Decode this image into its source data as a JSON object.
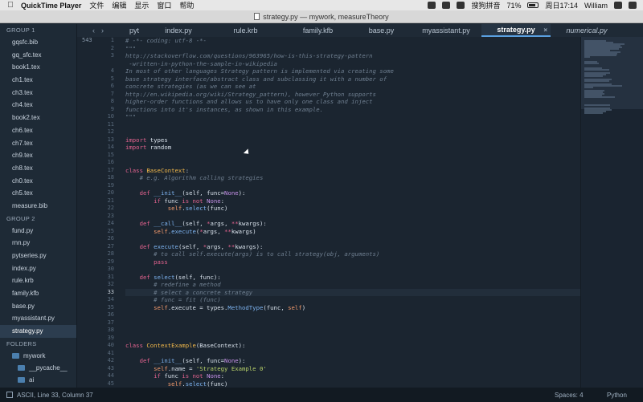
{
  "menubar": {
    "app_name": "QuickTime Player",
    "menus": [
      "文件",
      "编辑",
      "显示",
      "窗口",
      "帮助"
    ],
    "input_method": "搜狗拼音",
    "battery": "71%",
    "datetime": "周日17:14",
    "user": "William"
  },
  "window": {
    "title": "strategy.py — mywork, measureTheory"
  },
  "tabs": [
    {
      "label": "pyt"
    },
    {
      "label": "index.py"
    },
    {
      "label": "rule.krb"
    },
    {
      "label": "family.kfb"
    },
    {
      "label": "base.py"
    },
    {
      "label": "myassistant.py"
    },
    {
      "label": "strategy.py",
      "active": true,
      "close": "×"
    },
    {
      "label": "numerical.py"
    }
  ],
  "sidebar": {
    "group1_label": "GROUP 1",
    "group1": [
      "gqsfc.bib",
      "gq_sfc.tex",
      "book1.tex",
      "ch1.tex",
      "ch3.tex",
      "ch4.tex",
      "book2.tex",
      "ch6.tex",
      "ch7.tex",
      "ch9.tex",
      "ch8.tex",
      "ch0.tex",
      "ch5.tex",
      "measure.bib"
    ],
    "group2_label": "GROUP 2",
    "group2": [
      "fund.py",
      "rnn.py",
      "pytseries.py",
      "index.py",
      "rule.krb",
      "family.kfb",
      "base.py",
      "myassistant.py",
      "strategy.py"
    ],
    "folders_label": "FOLDERS",
    "folders": [
      {
        "name": "mywork"
      },
      {
        "name": "__pycache__"
      },
      {
        "name": "ai"
      }
    ]
  },
  "editor": {
    "scroll_line": "543",
    "current_line": 33,
    "lines": [
      {
        "n": 1,
        "t": [
          [
            "c-comment",
            "# -*- coding: utf-8 -*-"
          ]
        ]
      },
      {
        "n": 2,
        "t": [
          [
            "c-comment",
            "\"\"\""
          ]
        ]
      },
      {
        "n": 3,
        "t": [
          [
            "c-comment",
            "http://stackoverflow.com/questions/963965/how-is-this-strategy-pattern"
          ]
        ]
      },
      {
        "n": "",
        "t": [
          [
            "c-comment",
            " -written-in-python-the-sample-in-wikipedia"
          ]
        ]
      },
      {
        "n": 4,
        "t": [
          [
            "c-comment",
            "In most of other languages Strategy pattern is implemented via creating some"
          ]
        ]
      },
      {
        "n": 5,
        "t": [
          [
            "c-comment",
            "base strategy interface/abstract class and subclassing it with a number of"
          ]
        ]
      },
      {
        "n": 6,
        "t": [
          [
            "c-comment",
            "concrete strategies (as we can see at"
          ]
        ]
      },
      {
        "n": 7,
        "t": [
          [
            "c-comment",
            "http://en.wikipedia.org/wiki/Strategy_pattern), however Python supports"
          ]
        ]
      },
      {
        "n": 8,
        "t": [
          [
            "c-comment",
            "higher-order functions and allows us to have only one class and inject"
          ]
        ]
      },
      {
        "n": 9,
        "t": [
          [
            "c-comment",
            "functions into it's instances, as shown in this example."
          ]
        ]
      },
      {
        "n": 10,
        "t": [
          [
            "c-comment",
            "\"\"\""
          ]
        ]
      },
      {
        "n": 11,
        "t": []
      },
      {
        "n": 12,
        "t": []
      },
      {
        "n": 13,
        "t": [
          [
            "c-kw",
            "import"
          ],
          [
            "c-plain",
            " types"
          ]
        ]
      },
      {
        "n": 14,
        "t": [
          [
            "c-kw",
            "import"
          ],
          [
            "c-plain",
            " random"
          ]
        ]
      },
      {
        "n": 15,
        "t": []
      },
      {
        "n": 16,
        "t": []
      },
      {
        "n": 17,
        "t": [
          [
            "c-kw",
            "class"
          ],
          [
            "c-plain",
            " "
          ],
          [
            "c-cls",
            "BaseContext"
          ],
          [
            "c-plain",
            ":"
          ]
        ]
      },
      {
        "n": 18,
        "t": [
          [
            "c-comment",
            "    # e.g. Algorithm calling strategies"
          ]
        ]
      },
      {
        "n": 19,
        "t": []
      },
      {
        "n": 20,
        "t": [
          [
            "c-plain",
            "    "
          ],
          [
            "c-kw",
            "def"
          ],
          [
            "c-plain",
            " "
          ],
          [
            "c-def",
            "__init__"
          ],
          [
            "c-plain",
            "(self, func="
          ],
          [
            "c-num",
            "None"
          ],
          [
            "c-plain",
            "):"
          ]
        ]
      },
      {
        "n": 21,
        "t": [
          [
            "c-plain",
            "        "
          ],
          [
            "c-kw",
            "if"
          ],
          [
            "c-plain",
            " func "
          ],
          [
            "c-kw",
            "is not"
          ],
          [
            "c-plain",
            " "
          ],
          [
            "c-num",
            "None"
          ],
          [
            "c-plain",
            ":"
          ]
        ]
      },
      {
        "n": 22,
        "t": [
          [
            "c-plain",
            "            "
          ],
          [
            "c-self",
            "self"
          ],
          [
            "c-plain",
            "."
          ],
          [
            "c-def",
            "select"
          ],
          [
            "c-plain",
            "(func)"
          ]
        ]
      },
      {
        "n": 23,
        "t": []
      },
      {
        "n": 24,
        "t": [
          [
            "c-plain",
            "    "
          ],
          [
            "c-kw",
            "def"
          ],
          [
            "c-plain",
            " "
          ],
          [
            "c-def",
            "__call__"
          ],
          [
            "c-plain",
            "(self, "
          ],
          [
            "c-kw",
            "*"
          ],
          [
            "c-plain",
            "args, "
          ],
          [
            "c-kw",
            "**"
          ],
          [
            "c-plain",
            "kwargs):"
          ]
        ]
      },
      {
        "n": 25,
        "t": [
          [
            "c-plain",
            "        "
          ],
          [
            "c-self",
            "self"
          ],
          [
            "c-plain",
            "."
          ],
          [
            "c-def",
            "execute"
          ],
          [
            "c-plain",
            "("
          ],
          [
            "c-kw",
            "*"
          ],
          [
            "c-plain",
            "args, "
          ],
          [
            "c-kw",
            "**"
          ],
          [
            "c-plain",
            "kwargs)"
          ]
        ]
      },
      {
        "n": 26,
        "t": []
      },
      {
        "n": 27,
        "t": [
          [
            "c-plain",
            "    "
          ],
          [
            "c-kw",
            "def"
          ],
          [
            "c-plain",
            " "
          ],
          [
            "c-def",
            "execute"
          ],
          [
            "c-plain",
            "(self, "
          ],
          [
            "c-kw",
            "*"
          ],
          [
            "c-plain",
            "args, "
          ],
          [
            "c-kw",
            "**"
          ],
          [
            "c-plain",
            "kwargs):"
          ]
        ]
      },
      {
        "n": 28,
        "t": [
          [
            "c-comment",
            "        # to call self.execute(args) is to call strategy(obj, arguments)"
          ]
        ]
      },
      {
        "n": 29,
        "t": [
          [
            "c-plain",
            "        "
          ],
          [
            "c-kw",
            "pass"
          ]
        ]
      },
      {
        "n": 30,
        "t": []
      },
      {
        "n": 31,
        "t": [
          [
            "c-plain",
            "    "
          ],
          [
            "c-kw",
            "def"
          ],
          [
            "c-plain",
            " "
          ],
          [
            "c-def",
            "select"
          ],
          [
            "c-plain",
            "(self, func):"
          ]
        ]
      },
      {
        "n": 32,
        "t": [
          [
            "c-comment",
            "        # redefine a method"
          ]
        ]
      },
      {
        "n": 33,
        "t": [
          [
            "c-comment",
            "        # select a concrete strategy"
          ]
        ]
      },
      {
        "n": 34,
        "t": [
          [
            "c-comment",
            "        # func = fit (func)"
          ]
        ]
      },
      {
        "n": 35,
        "t": [
          [
            "c-plain",
            "        "
          ],
          [
            "c-self",
            "self"
          ],
          [
            "c-plain",
            ".execute = types."
          ],
          [
            "c-def",
            "MethodType"
          ],
          [
            "c-plain",
            "(func, "
          ],
          [
            "c-self",
            "self"
          ],
          [
            "c-plain",
            ")"
          ]
        ]
      },
      {
        "n": 36,
        "t": []
      },
      {
        "n": 37,
        "t": []
      },
      {
        "n": 38,
        "t": []
      },
      {
        "n": 39,
        "t": []
      },
      {
        "n": 40,
        "t": [
          [
            "c-kw",
            "class"
          ],
          [
            "c-plain",
            " "
          ],
          [
            "c-cls",
            "ContextExample"
          ],
          [
            "c-plain",
            "(BaseContext):"
          ]
        ]
      },
      {
        "n": 41,
        "t": []
      },
      {
        "n": 42,
        "t": [
          [
            "c-plain",
            "    "
          ],
          [
            "c-kw",
            "def"
          ],
          [
            "c-plain",
            " "
          ],
          [
            "c-def",
            "__init__"
          ],
          [
            "c-plain",
            "(self, func="
          ],
          [
            "c-num",
            "None"
          ],
          [
            "c-plain",
            "):"
          ]
        ]
      },
      {
        "n": 43,
        "t": [
          [
            "c-plain",
            "        "
          ],
          [
            "c-self",
            "self"
          ],
          [
            "c-plain",
            ".name = "
          ],
          [
            "c-str",
            "'Strategy Example 0'"
          ]
        ]
      },
      {
        "n": 44,
        "t": [
          [
            "c-plain",
            "        "
          ],
          [
            "c-kw",
            "if"
          ],
          [
            "c-plain",
            " func "
          ],
          [
            "c-kw",
            "is not"
          ],
          [
            "c-plain",
            " "
          ],
          [
            "c-num",
            "None"
          ],
          [
            "c-plain",
            ":"
          ]
        ]
      },
      {
        "n": 45,
        "t": [
          [
            "c-plain",
            "            "
          ],
          [
            "c-self",
            "self"
          ],
          [
            "c-plain",
            "."
          ],
          [
            "c-def",
            "select"
          ],
          [
            "c-plain",
            "(func)"
          ]
        ]
      },
      {
        "n": 46,
        "t": []
      }
    ]
  },
  "statusbar": {
    "position": "ASCII, Line 33, Column 37",
    "spaces": "Spaces: 4",
    "syntax": "Python"
  }
}
